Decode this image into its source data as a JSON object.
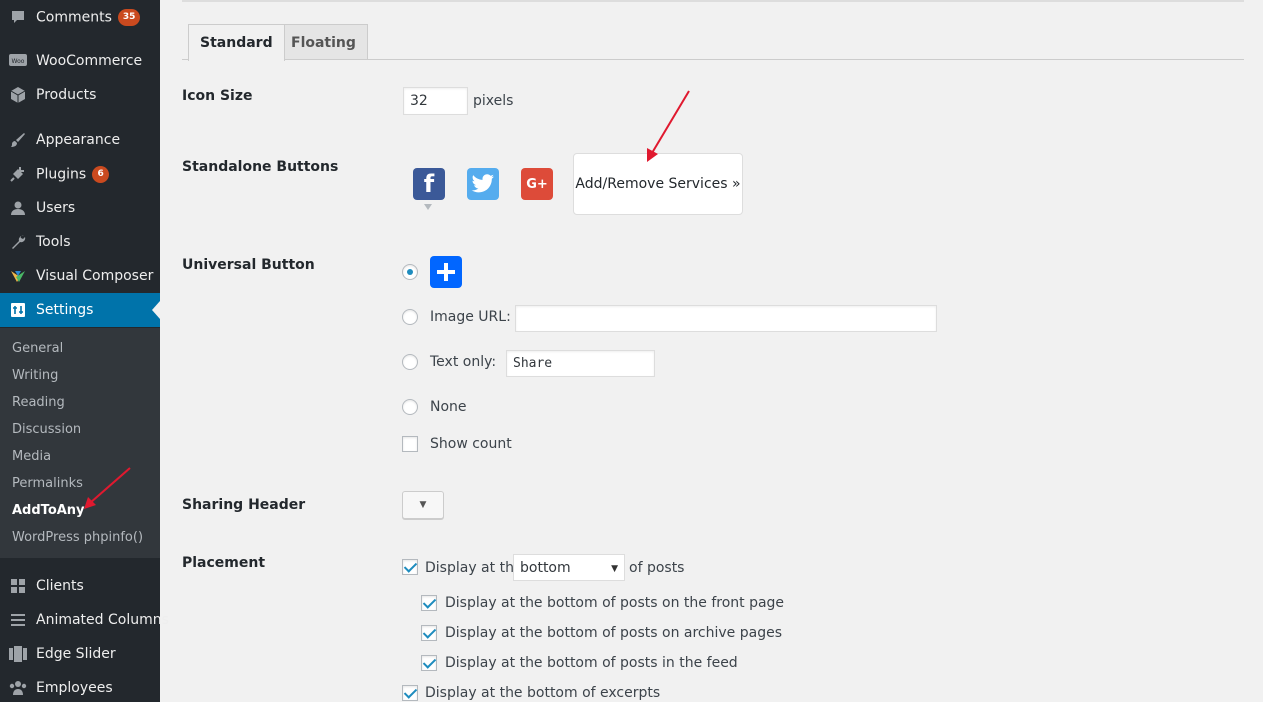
{
  "sidebar": {
    "menu": [
      {
        "label": "Comments",
        "icon": "comment-icon",
        "badge": "35"
      },
      {
        "label": "WooCommerce",
        "icon": "woocommerce-icon"
      },
      {
        "label": "Products",
        "icon": "box-icon"
      },
      {
        "label": "Appearance",
        "icon": "paintbrush-icon"
      },
      {
        "label": "Plugins",
        "icon": "plugin-icon",
        "badge": "6"
      },
      {
        "label": "Users",
        "icon": "user-icon"
      },
      {
        "label": "Tools",
        "icon": "wrench-icon"
      },
      {
        "label": "Visual Composer",
        "icon": "visual-composer-icon"
      },
      {
        "label": "Settings",
        "icon": "settings-icon"
      },
      {
        "label": "Clients",
        "icon": "grid-icon"
      },
      {
        "label": "Animated Columns",
        "icon": "list-icon"
      },
      {
        "label": "Edge Slider",
        "icon": "slider-icon"
      },
      {
        "label": "Employees",
        "icon": "group-icon"
      }
    ],
    "submenu": [
      "General",
      "Writing",
      "Reading",
      "Discussion",
      "Media",
      "Permalinks",
      "AddToAny",
      "WordPress phpinfo()"
    ]
  },
  "tabs": {
    "standard": "Standard",
    "floating": "Floating"
  },
  "form": {
    "icon_size": {
      "label": "Icon Size",
      "value": "32",
      "unit": "pixels"
    },
    "standalone": {
      "label": "Standalone Buttons",
      "services": [
        {
          "name": "facebook",
          "icon": "facebook-icon",
          "glyph": "f",
          "color": "#3b5998"
        },
        {
          "name": "twitter",
          "icon": "twitter-icon",
          "color": "#55acee"
        },
        {
          "name": "google-plus",
          "icon": "google-plus-icon",
          "glyph": "G+",
          "color": "#dd4b39"
        }
      ],
      "add_remove": "Add/Remove Services »"
    },
    "universal": {
      "label": "Universal Button",
      "image_url_label": "Image URL:",
      "image_url_value": "",
      "text_only_label": "Text only:",
      "text_only_value": "Share",
      "none_label": "None",
      "show_count_label": "Show count",
      "selected": "icon",
      "icon_color": "#0166ff"
    },
    "sharing_header": {
      "label": "Sharing Header",
      "button_glyph": "▼"
    },
    "placement": {
      "label": "Placement",
      "display_prefix": "Display at the",
      "position": "bottom",
      "display_suffix": "of posts",
      "options": [
        "Display at the bottom of posts on the front page",
        "Display at the bottom of posts on archive pages",
        "Display at the bottom of posts in the feed"
      ],
      "excerpts": "Display at the bottom of excerpts"
    }
  },
  "colors": {
    "accent": "#0073aa",
    "annotation_arrow": "#e0192f"
  }
}
